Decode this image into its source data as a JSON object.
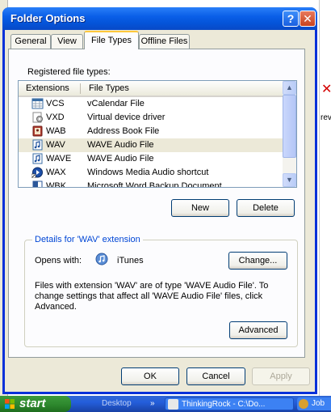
{
  "window": {
    "title": "Folder Options",
    "help_label": "?",
    "close_label": "✕"
  },
  "tabs": [
    {
      "label": "General",
      "active": false
    },
    {
      "label": "View",
      "active": false
    },
    {
      "label": "File Types",
      "active": true
    },
    {
      "label": "Offline Files",
      "active": false
    }
  ],
  "registered_label": "Registered file types:",
  "list": {
    "columns": [
      "Extensions",
      "File Types"
    ],
    "rows": [
      {
        "ext": "VCS",
        "type": "vCalendar File",
        "icon": "vcalendar-icon",
        "selected": false
      },
      {
        "ext": "VXD",
        "type": "Virtual device driver",
        "icon": "driver-icon",
        "selected": false
      },
      {
        "ext": "WAB",
        "type": "Address Book File",
        "icon": "address-book-icon",
        "selected": false
      },
      {
        "ext": "WAV",
        "type": "WAVE Audio File",
        "icon": "audio-file-icon",
        "selected": true
      },
      {
        "ext": "WAVE",
        "type": "WAVE Audio File",
        "icon": "audio-file-icon",
        "selected": false
      },
      {
        "ext": "WAX",
        "type": "Windows Media Audio shortcut",
        "icon": "media-shortcut-icon",
        "selected": false
      },
      {
        "ext": "WBK",
        "type": "Microsoft Word Backup Document",
        "icon": "word-doc-icon",
        "selected": false
      }
    ],
    "scroll_up": "▲",
    "scroll_down": "▼"
  },
  "buttons": {
    "new": "New",
    "delete": "Delete",
    "change": "Change...",
    "advanced": "Advanced",
    "ok": "OK",
    "cancel": "Cancel",
    "apply": "Apply"
  },
  "details": {
    "group_title": "Details for 'WAV' extension",
    "opens_with_label": "Opens with:",
    "app_name": "iTunes",
    "description": "Files with extension 'WAV' are of type 'WAVE Audio File'.  To change settings that affect all 'WAVE Audio File' files, click Advanced."
  },
  "background": {
    "right_text": "rev"
  },
  "taskbar": {
    "start_label": "start",
    "tasks": [
      "Desktop",
      "»",
      "ThinkingRock - C:\\Do...",
      "Job"
    ]
  },
  "colors": {
    "title_bar": "#0454d9",
    "dialog_bg": "#ece9d8",
    "group_title": "#0046d5",
    "taskbar": "#245edb",
    "start_button": "#2f8a2f"
  }
}
